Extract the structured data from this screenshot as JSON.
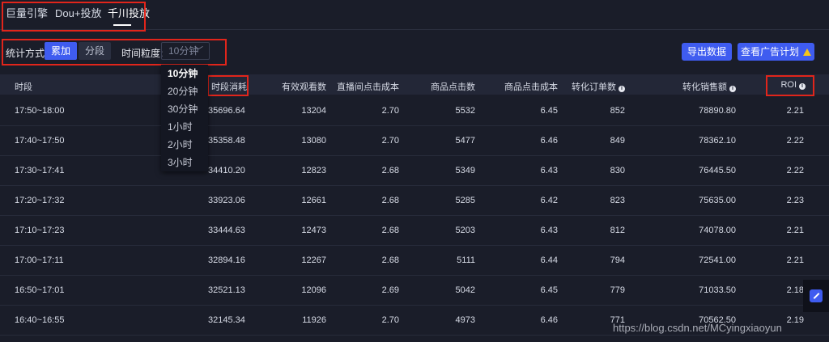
{
  "tabs": [
    "巨量引擎",
    "Dou+投放",
    "千川投放"
  ],
  "active_tab": "千川投放",
  "stat": {
    "label": "统计方式:",
    "options": [
      "累加",
      "分段"
    ],
    "selected": "累加",
    "granularity_label": "时间粒度:",
    "granularity_value": "10分钟",
    "granularity_options": [
      "10分钟",
      "20分钟",
      "30分钟",
      "1小时",
      "2小时",
      "3小时"
    ]
  },
  "buttons": {
    "export": "导出数据",
    "view_plan": "查看广告计划"
  },
  "table": {
    "headers": [
      "时段",
      "时段消耗",
      "有效观看数",
      "直播间点击成本",
      "商品点击数",
      "商品点击成本",
      "转化订单数",
      "转化销售额",
      "ROI"
    ],
    "rows": [
      [
        "17:50~18:00",
        "35696.64",
        "13204",
        "2.70",
        "5532",
        "6.45",
        "852",
        "78890.80",
        "2.21"
      ],
      [
        "17:40~17:50",
        "35358.48",
        "13080",
        "2.70",
        "5477",
        "6.46",
        "849",
        "78362.10",
        "2.22"
      ],
      [
        "17:30~17:41",
        "34410.20",
        "12823",
        "2.68",
        "5349",
        "6.43",
        "830",
        "76445.50",
        "2.22"
      ],
      [
        "17:20~17:32",
        "33923.06",
        "12661",
        "2.68",
        "5285",
        "6.42",
        "823",
        "75635.00",
        "2.23"
      ],
      [
        "17:10~17:23",
        "33444.63",
        "12473",
        "2.68",
        "5203",
        "6.43",
        "812",
        "74078.00",
        "2.21"
      ],
      [
        "17:00~17:11",
        "32894.16",
        "12267",
        "2.68",
        "5111",
        "6.44",
        "794",
        "72541.00",
        "2.21"
      ],
      [
        "16:50~17:01",
        "32521.13",
        "12096",
        "2.69",
        "5042",
        "6.45",
        "779",
        "71033.50",
        "2.18"
      ],
      [
        "16:40~16:55",
        "32145.34",
        "11926",
        "2.70",
        "4973",
        "6.46",
        "771",
        "70562.50",
        "2.19"
      ]
    ]
  },
  "watermark": "https://blog.csdn.net/MCyingxiaoyun",
  "colors": {
    "background": "#1a1d29",
    "accent": "#3f5cf0",
    "highlight": "#e1251b",
    "warning": "#f5c518"
  }
}
